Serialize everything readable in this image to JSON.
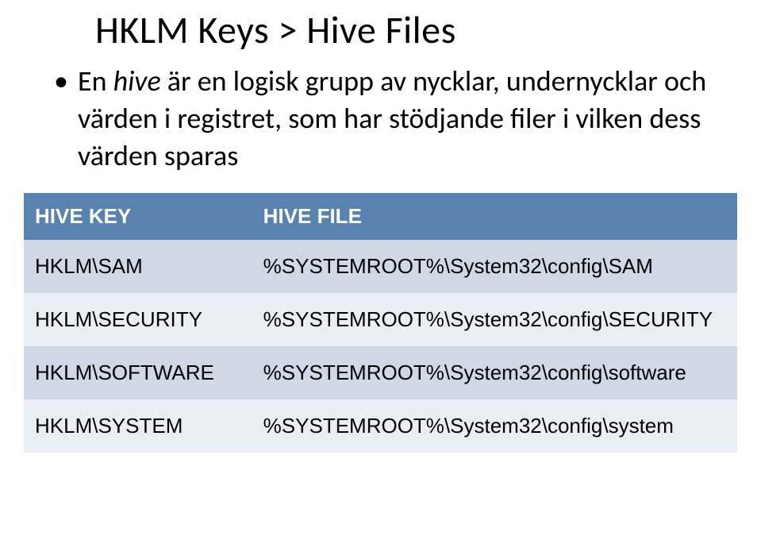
{
  "title": "HKLM Keys > Hive Files",
  "bullet": {
    "prefix": "En ",
    "italic": "hive",
    "rest": " är en logisk grupp av nycklar, undernycklar och värden i registret, som har stödjande filer i vilken dess värden sparas"
  },
  "table": {
    "header": {
      "key": "HIVE KEY",
      "file": "HIVE FILE"
    },
    "rows": [
      {
        "key": "HKLM\\SAM",
        "file": "%SYSTEMROOT%\\System32\\config\\SAM"
      },
      {
        "key": "HKLM\\SECURITY",
        "file": "%SYSTEMROOT%\\System32\\config\\SECURITY"
      },
      {
        "key": "HKLM\\SOFTWARE",
        "file": "%SYSTEMROOT%\\System32\\config\\software"
      },
      {
        "key": "HKLM\\SYSTEM",
        "file": "%SYSTEMROOT%\\System32\\config\\system"
      }
    ]
  }
}
